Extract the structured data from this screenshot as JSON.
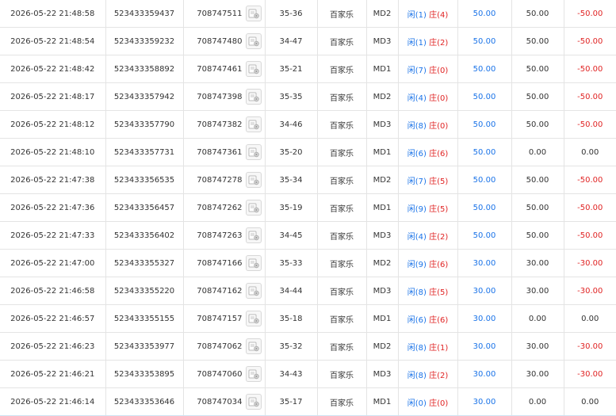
{
  "colors": {
    "blue": "#1a73e8",
    "red": "#e02424",
    "border": "#e4e4e4"
  },
  "rows": [
    {
      "time": "2026-05-22 21:48:58",
      "bet_id": "523433359437",
      "round_id": "708747511",
      "shoe": "35-36",
      "game": "百家乐",
      "table": "MD2",
      "player_label": "闲",
      "player_count": "(1)",
      "banker_label": "庄",
      "banker_count": "(4)",
      "bet": "50.00",
      "valid": "50.00",
      "win": "-50.00"
    },
    {
      "time": "2026-05-22 21:48:54",
      "bet_id": "523433359232",
      "round_id": "708747480",
      "shoe": "34-47",
      "game": "百家乐",
      "table": "MD3",
      "player_label": "闲",
      "player_count": "(1)",
      "banker_label": "庄",
      "banker_count": "(2)",
      "bet": "50.00",
      "valid": "50.00",
      "win": "-50.00"
    },
    {
      "time": "2026-05-22 21:48:42",
      "bet_id": "523433358892",
      "round_id": "708747461",
      "shoe": "35-21",
      "game": "百家乐",
      "table": "MD1",
      "player_label": "闲",
      "player_count": "(7)",
      "banker_label": "庄",
      "banker_count": "(0)",
      "bet": "50.00",
      "valid": "50.00",
      "win": "-50.00"
    },
    {
      "time": "2026-05-22 21:48:17",
      "bet_id": "523433357942",
      "round_id": "708747398",
      "shoe": "35-35",
      "game": "百家乐",
      "table": "MD2",
      "player_label": "闲",
      "player_count": "(4)",
      "banker_label": "庄",
      "banker_count": "(0)",
      "bet": "50.00",
      "valid": "50.00",
      "win": "-50.00"
    },
    {
      "time": "2026-05-22 21:48:12",
      "bet_id": "523433357790",
      "round_id": "708747382",
      "shoe": "34-46",
      "game": "百家乐",
      "table": "MD3",
      "player_label": "闲",
      "player_count": "(8)",
      "banker_label": "庄",
      "banker_count": "(0)",
      "bet": "50.00",
      "valid": "50.00",
      "win": "-50.00"
    },
    {
      "time": "2026-05-22 21:48:10",
      "bet_id": "523433357731",
      "round_id": "708747361",
      "shoe": "35-20",
      "game": "百家乐",
      "table": "MD1",
      "player_label": "闲",
      "player_count": "(6)",
      "banker_label": "庄",
      "banker_count": "(6)",
      "bet": "50.00",
      "valid": "0.00",
      "win": "0.00"
    },
    {
      "time": "2026-05-22 21:47:38",
      "bet_id": "523433356535",
      "round_id": "708747278",
      "shoe": "35-34",
      "game": "百家乐",
      "table": "MD2",
      "player_label": "闲",
      "player_count": "(7)",
      "banker_label": "庄",
      "banker_count": "(5)",
      "bet": "50.00",
      "valid": "50.00",
      "win": "-50.00"
    },
    {
      "time": "2026-05-22 21:47:36",
      "bet_id": "523433356457",
      "round_id": "708747262",
      "shoe": "35-19",
      "game": "百家乐",
      "table": "MD1",
      "player_label": "闲",
      "player_count": "(9)",
      "banker_label": "庄",
      "banker_count": "(5)",
      "bet": "50.00",
      "valid": "50.00",
      "win": "-50.00"
    },
    {
      "time": "2026-05-22 21:47:33",
      "bet_id": "523433356402",
      "round_id": "708747263",
      "shoe": "34-45",
      "game": "百家乐",
      "table": "MD3",
      "player_label": "闲",
      "player_count": "(4)",
      "banker_label": "庄",
      "banker_count": "(2)",
      "bet": "50.00",
      "valid": "50.00",
      "win": "-50.00"
    },
    {
      "time": "2026-05-22 21:47:00",
      "bet_id": "523433355327",
      "round_id": "708747166",
      "shoe": "35-33",
      "game": "百家乐",
      "table": "MD2",
      "player_label": "闲",
      "player_count": "(9)",
      "banker_label": "庄",
      "banker_count": "(6)",
      "bet": "30.00",
      "valid": "30.00",
      "win": "-30.00"
    },
    {
      "time": "2026-05-22 21:46:58",
      "bet_id": "523433355220",
      "round_id": "708747162",
      "shoe": "34-44",
      "game": "百家乐",
      "table": "MD3",
      "player_label": "闲",
      "player_count": "(8)",
      "banker_label": "庄",
      "banker_count": "(5)",
      "bet": "30.00",
      "valid": "30.00",
      "win": "-30.00"
    },
    {
      "time": "2026-05-22 21:46:57",
      "bet_id": "523433355155",
      "round_id": "708747157",
      "shoe": "35-18",
      "game": "百家乐",
      "table": "MD1",
      "player_label": "闲",
      "player_count": "(6)",
      "banker_label": "庄",
      "banker_count": "(6)",
      "bet": "30.00",
      "valid": "0.00",
      "win": "0.00"
    },
    {
      "time": "2026-05-22 21:46:23",
      "bet_id": "523433353977",
      "round_id": "708747062",
      "shoe": "35-32",
      "game": "百家乐",
      "table": "MD2",
      "player_label": "闲",
      "player_count": "(8)",
      "banker_label": "庄",
      "banker_count": "(1)",
      "bet": "30.00",
      "valid": "30.00",
      "win": "-30.00"
    },
    {
      "time": "2026-05-22 21:46:21",
      "bet_id": "523433353895",
      "round_id": "708747060",
      "shoe": "34-43",
      "game": "百家乐",
      "table": "MD3",
      "player_label": "闲",
      "player_count": "(8)",
      "banker_label": "庄",
      "banker_count": "(2)",
      "bet": "30.00",
      "valid": "30.00",
      "win": "-30.00"
    },
    {
      "time": "2026-05-22 21:46:14",
      "bet_id": "523433353646",
      "round_id": "708747034",
      "shoe": "35-17",
      "game": "百家乐",
      "table": "MD1",
      "player_label": "闲",
      "player_count": "(0)",
      "banker_label": "庄",
      "banker_count": "(0)",
      "bet": "30.00",
      "valid": "0.00",
      "win": "0.00"
    }
  ]
}
